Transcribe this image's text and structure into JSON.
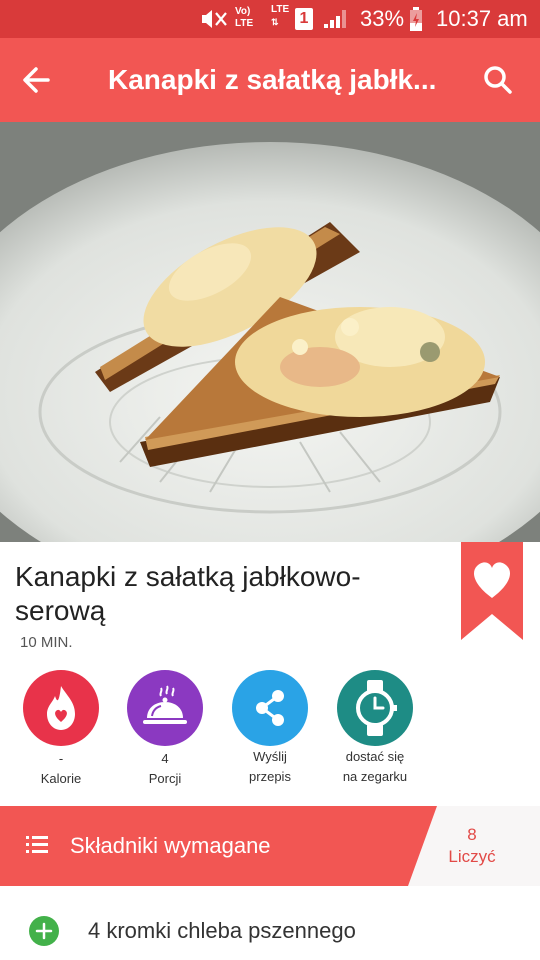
{
  "status_bar": {
    "volte_top": "Vo)",
    "volte_bottom": "LTE",
    "lte_label": "LTE",
    "sim_number": "1",
    "battery_percent": "33%",
    "time": "10:37 am"
  },
  "app_bar": {
    "title": "Kanapki z sałatką jabłk..."
  },
  "recipe": {
    "title": "Kanapki z sałatką jabłkowo-serową",
    "time": "10 MIN."
  },
  "actions": [
    {
      "value": "-",
      "label": "Kalorie",
      "color": "#e8334a",
      "icon": "calorie-flame-icon"
    },
    {
      "value": "4",
      "label": "Porcji",
      "color": "#8b39c1",
      "icon": "serving-cloche-icon"
    },
    {
      "value": "Wyślij",
      "label": "przepis",
      "color": "#2aa3e6",
      "icon": "share-icon"
    },
    {
      "value": "dostać się",
      "label": "na zegarku",
      "color": "#1e8c85",
      "icon": "watch-icon"
    }
  ],
  "ingredients": {
    "title": "Składniki wymagane",
    "count": "8",
    "count_label": "Liczyć",
    "items": [
      "4 kromki chleba pszennego"
    ]
  },
  "colors": {
    "status_bar": "#d93a3a",
    "app_bar": "#f25653",
    "accent": "#f25653",
    "add_button": "#43b14a"
  }
}
